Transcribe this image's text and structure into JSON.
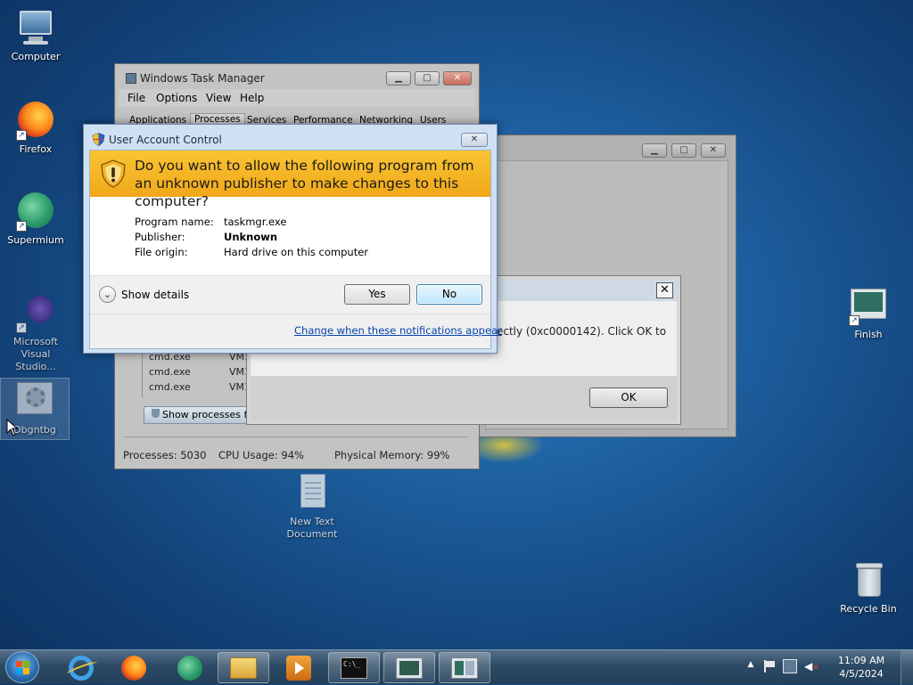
{
  "desktop": {
    "icons": [
      {
        "name": "Computer"
      },
      {
        "name": "Firefox"
      },
      {
        "name": "Supermium"
      },
      {
        "name": "Microsoft Visual Studio..."
      },
      {
        "name": "Dbgntbg"
      },
      {
        "name": "New Text Document"
      },
      {
        "name": "Finish"
      },
      {
        "name": "Recycle Bin"
      }
    ]
  },
  "task_manager": {
    "title": "Windows Task Manager",
    "menu": [
      "File",
      "Options",
      "View",
      "Help"
    ],
    "tabs": [
      "Applications",
      "Processes",
      "Services",
      "Performance",
      "Networking",
      "Users"
    ],
    "rows": [
      {
        "image": "cmd.exe",
        "user": "VM1"
      },
      {
        "image": "cmd.exe",
        "user": "VM1"
      },
      {
        "image": "cmd.exe",
        "user": "VM1"
      }
    ],
    "show_processes_label": "Show processes fro",
    "status": {
      "processes": "Processes: 5030",
      "cpu": "CPU Usage: 94%",
      "memory": "Physical Memory: 99%"
    }
  },
  "error_dialog": {
    "message": "ectly (0xc0000142). Click OK to",
    "ok_label": "OK",
    "close_glyph": "✕"
  },
  "uac": {
    "title": "User Account Control",
    "question": "Do you want to allow the following program from an unknown publisher to make changes to this computer?",
    "fields": [
      {
        "label": "Program name:",
        "value": "taskmgr.exe",
        "bold": false
      },
      {
        "label": "Publisher:",
        "value": "Unknown",
        "bold": true
      },
      {
        "label": "File origin:",
        "value": "Hard drive on this computer",
        "bold": false
      }
    ],
    "show_details": "Show details",
    "yes_label": "Yes",
    "no_label": "No",
    "change_link": "Change when these notifications appear",
    "close_glyph": "✕"
  },
  "taskbar": {
    "cmd_glyph": "C:\\_",
    "clock": {
      "time": "11:09 AM",
      "date": "4/5/2024"
    }
  },
  "colors": {
    "uac_banner": "#f0a81a",
    "link": "#0645ad",
    "taskbar": "#2d4a64"
  }
}
